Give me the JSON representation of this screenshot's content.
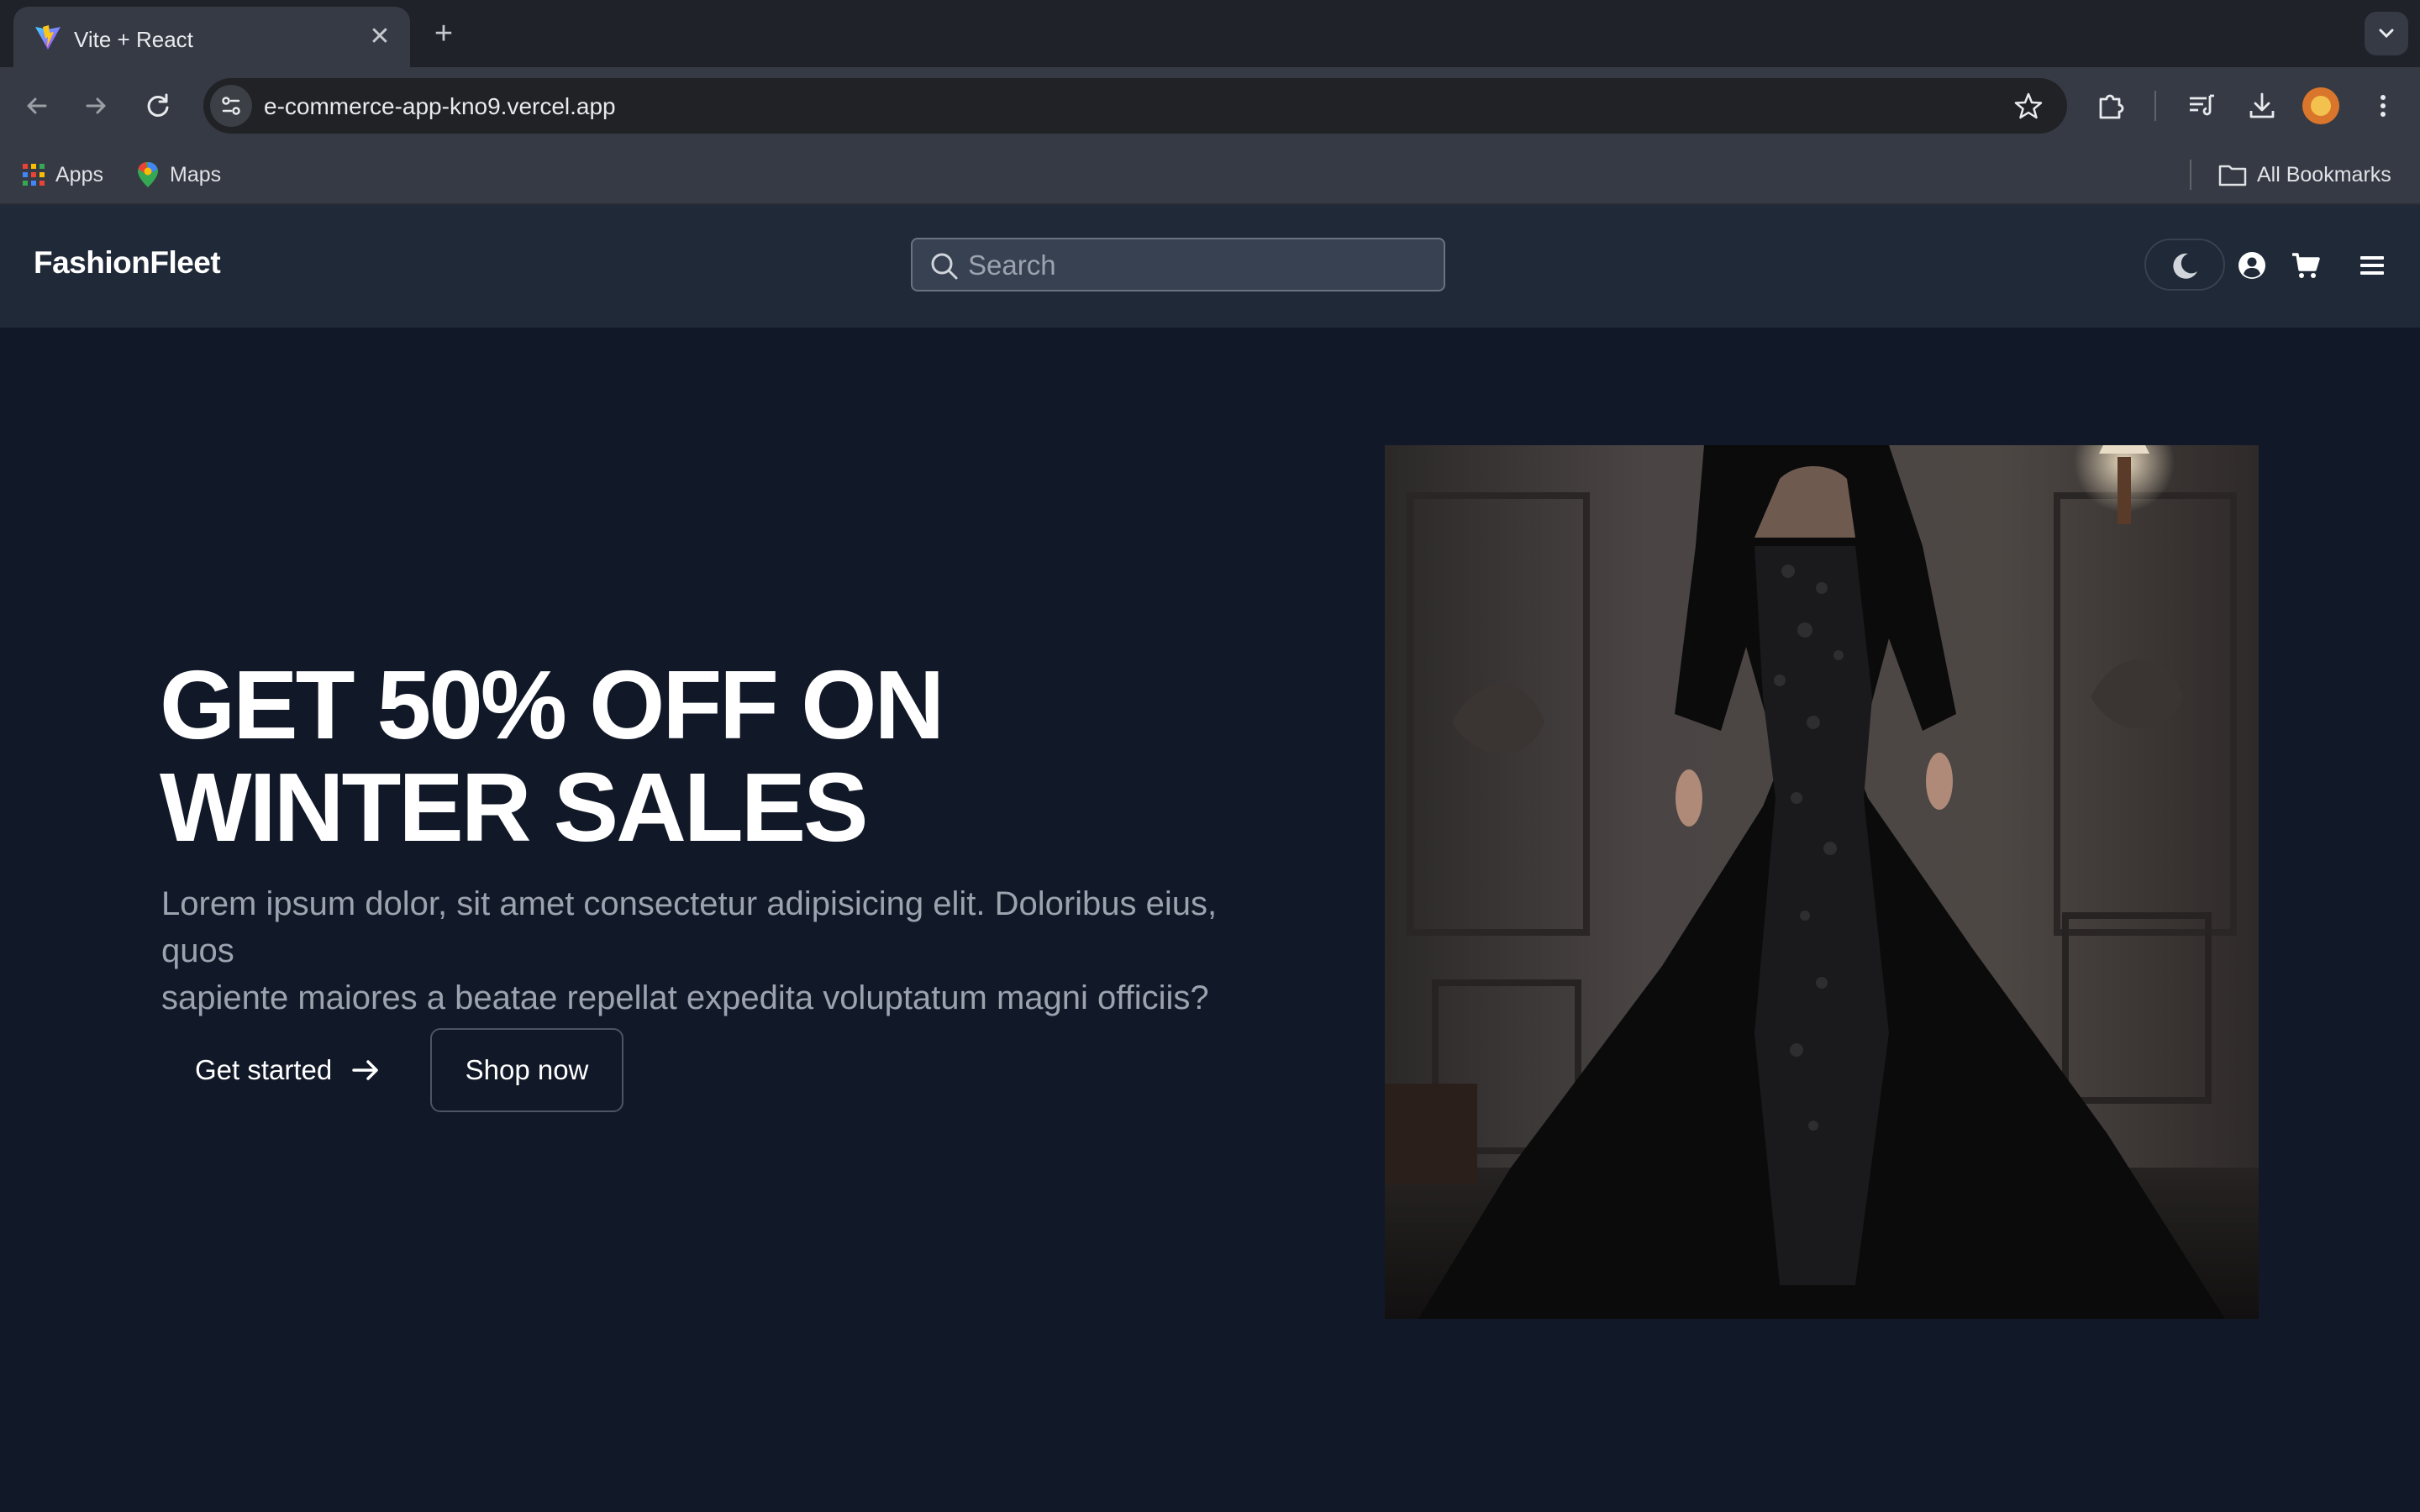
{
  "browser": {
    "tab_title": "Vite + React",
    "url": "e-commerce-app-kno9.vercel.app",
    "bookmarks": [
      {
        "label": "Apps",
        "icon": "apps-grid-icon"
      },
      {
        "label": "Maps",
        "icon": "maps-pin-icon"
      }
    ],
    "all_bookmarks_label": "All Bookmarks"
  },
  "header": {
    "brand": "FashionFleet",
    "search_placeholder": "Search"
  },
  "hero": {
    "title_line1": "GET 50% OFF ON",
    "title_line2": "WINTER SALES",
    "description_line1": "Lorem ipsum dolor, sit amet consectetur adipisicing elit. Doloribus eius, quos",
    "description_line2": "sapiente maiores a beatae repellat expedita voluptatum magni officiis?",
    "get_started_label": "Get started",
    "shop_now_label": "Shop now"
  },
  "colors": {
    "page_bg": "#111827",
    "header_bg": "#1f2937",
    "text_primary": "#ffffff",
    "text_muted": "#9ca3af"
  }
}
